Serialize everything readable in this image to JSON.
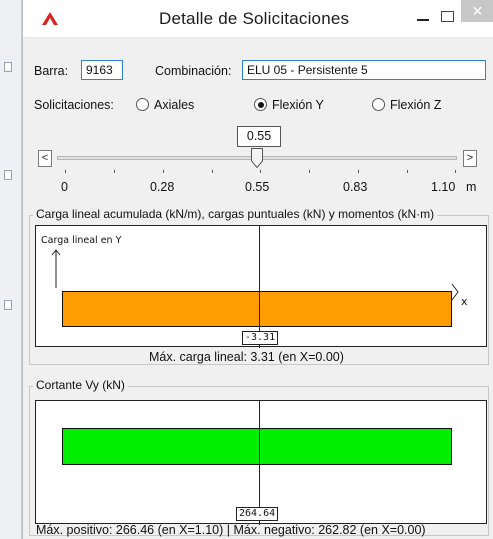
{
  "window": {
    "title": "Detalle de Solicitaciones",
    "close_glyph": "✕",
    "icon": "red-caret-app-icon"
  },
  "form": {
    "barra_label": "Barra:",
    "barra_value": "9163",
    "combinacion_label": "Combinación:",
    "combinacion_value": "ELU 05 - Persistente 5",
    "solicitaciones_label": "Solicitaciones:",
    "options": [
      "Axiales",
      "Flexión Y",
      "Flexión Z"
    ],
    "selected_option": "Flexión Y"
  },
  "slider": {
    "current_value": "0.55",
    "position_fraction": 0.5,
    "tick_labels": [
      "0",
      "0.28",
      "0.55",
      "0.83",
      "1.10"
    ],
    "unit": "m",
    "left_arrow": "<",
    "right_arrow": ">"
  },
  "load_panel": {
    "group_title": "Carga lineal acumulada (kN/m), cargas puntuales (kN) y momentos (kN·m)",
    "axis_title": "Carga lineal en Y",
    "x_label": "x",
    "value_at_cursor": "-3.31",
    "summary": "Máx. carga lineal: 3.31 (en X=0.00)",
    "bar_color": "#ff9d00"
  },
  "shear_panel": {
    "group_title": "Cortante Vy (kN)",
    "value_at_cursor": "264.64",
    "summary": "Máx. positivo: 266.46 (en X=1.10)  |  Máx. negativo: 262.82 (en X=0.00)",
    "bar_color": "#00ee00"
  }
}
